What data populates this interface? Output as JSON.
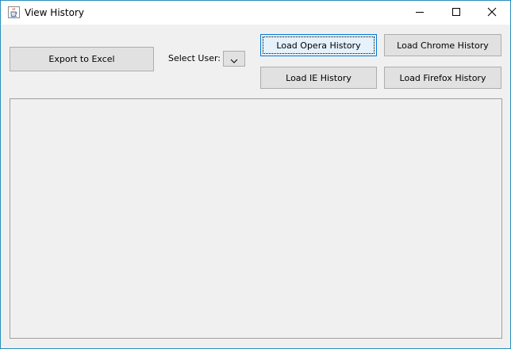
{
  "window": {
    "title": "View History",
    "icon": "java-cup-icon",
    "controls": [
      "minimize-icon",
      "maximize-icon",
      "close-icon"
    ],
    "accent_color": "#0078d7"
  },
  "toolbar": {
    "export_label": "Export to Excel",
    "select_user_label": "Select User:",
    "user_select_value": "",
    "load_opera_label": "Load Opera History",
    "load_chrome_label": "Load Chrome History",
    "load_ie_label": "Load IE History",
    "load_firefox_label": "Load Firefox History"
  },
  "history_panel": {
    "rows": []
  }
}
